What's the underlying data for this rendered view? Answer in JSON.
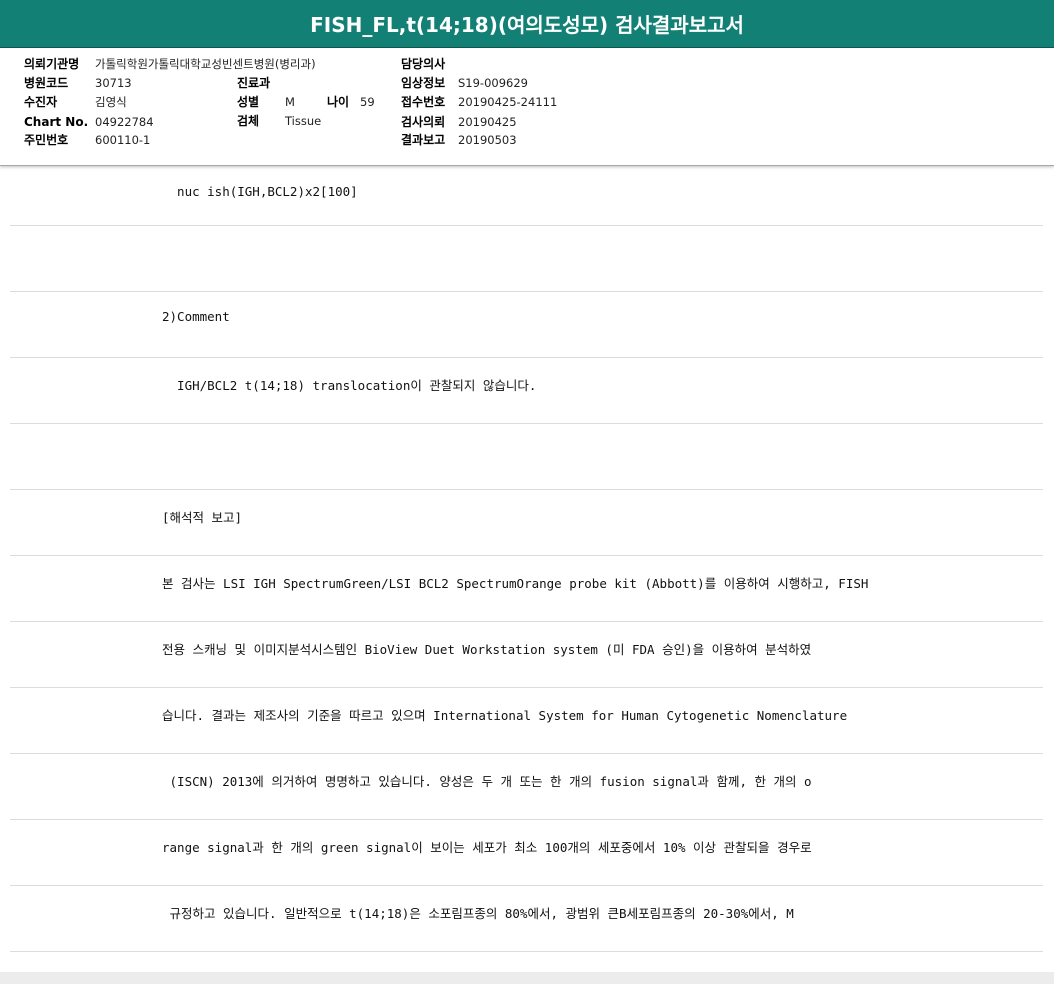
{
  "header": {
    "title": "FISH_FL,t(14;18)(여의도성모) 검사결과보고서"
  },
  "info": {
    "institution_label": "의뢰기관명",
    "institution_value": "가톨릭학원가톨릭대학교성빈센트병원(병리과)",
    "doctor_label": "담당의사",
    "doctor_value": "",
    "hospital_code_label": "병원코드",
    "hospital_code_value": "30713",
    "department_label": "진료과",
    "department_value": "",
    "clinical_info_label": "임상정보",
    "clinical_info_value": "S19-009629",
    "patient_label": "수진자",
    "patient_value": "김영식",
    "sex_label": "성별",
    "sex_value": "M",
    "age_label": "나이",
    "age_value": "59",
    "receipt_no_label": "접수번호",
    "receipt_no_value": "20190425-24111",
    "chart_no_label": "Chart No.",
    "chart_no_value": "04922784",
    "specimen_label": "검체",
    "specimen_value": "Tissue",
    "request_date_label": "검사의뢰",
    "request_date_value": "20190425",
    "resident_no_label": "주민번호",
    "resident_no_value": "600110-1",
    "report_date_label": "결과보고",
    "report_date_value": "20190503"
  },
  "report_lines": [
    "  nuc ish(IGH,BCL2)x2[100]",
    "",
    "2)Comment",
    "  IGH/BCL2 t(14;18) translocation이 관찰되지 않습니다.",
    "",
    "[해석적 보고]",
    "본 검사는 LSI IGH SpectrumGreen/LSI BCL2 SpectrumOrange probe kit (Abbott)를 이용하여 시행하고, FISH",
    "전용 스캐닝 및 이미지분석시스템인 BioView Duet Workstation system (미 FDA 승인)을 이용하여 분석하였",
    "습니다. 결과는 제조사의 기준을 따르고 있으며 International System for Human Cytogenetic Nomenclature",
    " (ISCN) 2013에 의거하여 명명하고 있습니다. 양성은 두 개 또는 한 개의 fusion signal과 함께, 한 개의 o",
    "range signal과 한 개의 green signal이 보이는 세포가 최소 100개의 세포중에서 10% 이상 관찰되을 경우로",
    " 규정하고 있습니다. 일반적으로 t(14;18)은 소포림프종의 80%에서, 광범위 큰B세포림프종의 20-30%에서, M"
  ]
}
